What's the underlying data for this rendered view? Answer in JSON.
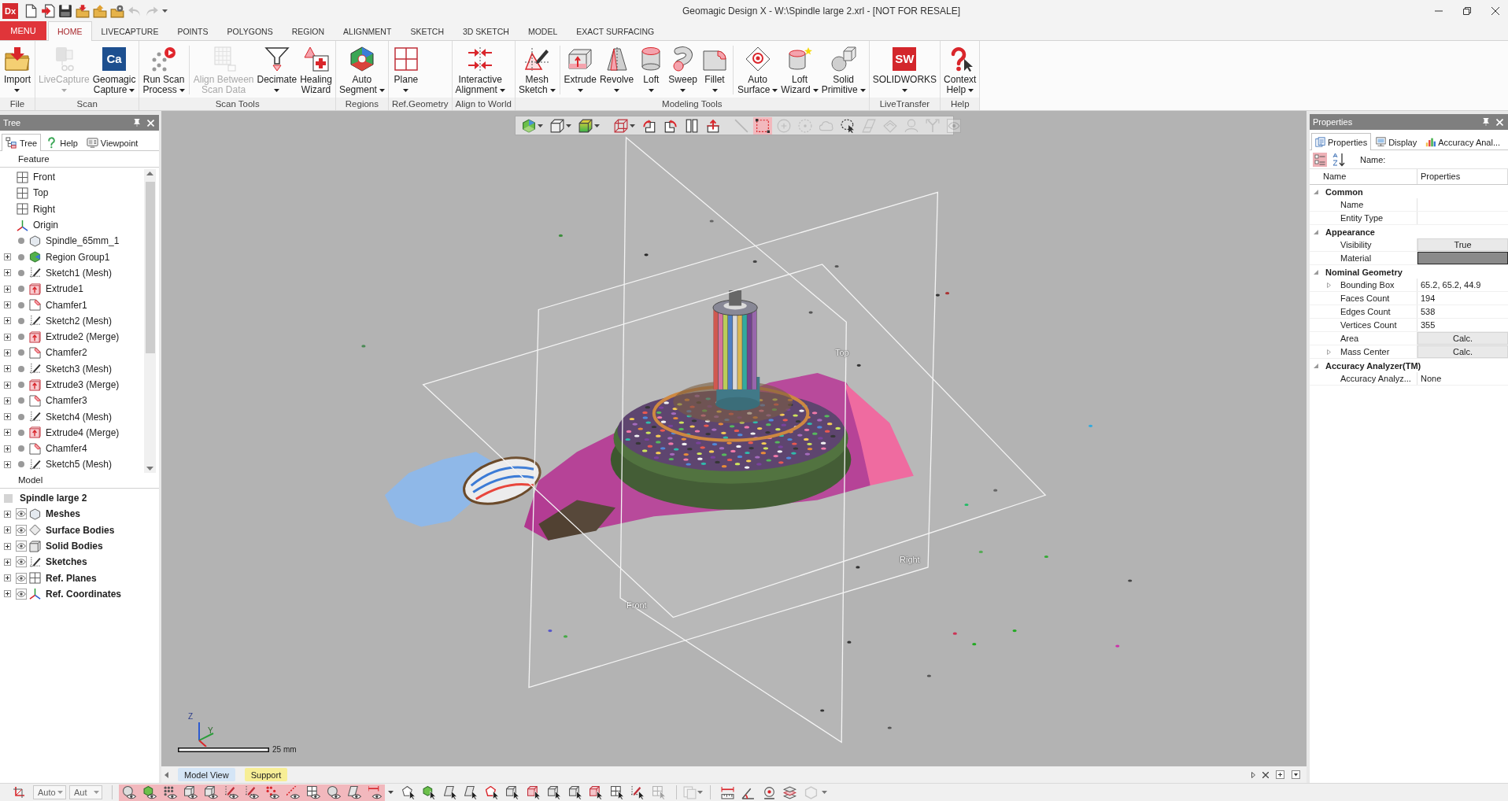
{
  "window": {
    "app_logo": "Dx",
    "title": "Geomagic Design X - W:\\Spindle large 2.xrl - [NOT FOR RESALE]"
  },
  "quick_access": [
    {
      "disabled": false
    },
    {
      "disabled": false
    },
    {
      "disabled": false
    },
    {
      "disabled": false
    },
    {
      "disabled": false
    },
    {
      "disabled": false
    },
    {
      "disabled": true
    },
    {
      "disabled": true
    }
  ],
  "ribbon": {
    "menu": "MENU",
    "tabs": [
      {
        "label": "HOME",
        "selected": true
      },
      {
        "label": "LIVECAPTURE",
        "selected": false
      },
      {
        "label": "POINTS",
        "selected": false
      },
      {
        "label": "POLYGONS",
        "selected": false
      },
      {
        "label": "REGION",
        "selected": false
      },
      {
        "label": "ALIGNMENT",
        "selected": false
      },
      {
        "label": "SKETCH",
        "selected": false
      },
      {
        "label": "3D SKETCH",
        "selected": false
      },
      {
        "label": "MODEL",
        "selected": false
      },
      {
        "label": "EXACT SURFACING",
        "selected": false
      }
    ],
    "groups": [
      {
        "label": "File",
        "sections": [
          [
            {
              "label": "Import",
              "dropdown": true,
              "disabled": false
            }
          ]
        ]
      },
      {
        "label": "Scan",
        "sections": [
          [
            {
              "label": "LiveCapture",
              "dropdown": true,
              "disabled": true
            },
            {
              "label": "Geomagic\nCapture",
              "badge": "Ca",
              "dropdown": true,
              "disabled": false
            }
          ]
        ]
      },
      {
        "label": "Scan Tools",
        "sections": [
          [
            {
              "label": "Run Scan\nProcess",
              "dropdown": true,
              "disabled": false
            }
          ],
          [
            {
              "label": "Align Between\nScan Data",
              "dropdown": false,
              "disabled": true
            },
            {
              "label": "Decimate",
              "dropdown": true,
              "disabled": false
            },
            {
              "label": "Healing\nWizard",
              "dropdown": false,
              "disabled": false
            }
          ]
        ]
      },
      {
        "label": "Regions",
        "sections": [
          [
            {
              "label": "Auto\nSegment",
              "dropdown": true,
              "disabled": false
            }
          ]
        ]
      },
      {
        "label": "Ref.Geometry",
        "sections": [
          [
            {
              "label": "Plane",
              "dropdown": true,
              "disabled": false
            }
          ]
        ]
      },
      {
        "label": "Align to World",
        "sections": [
          [
            {
              "label": "Interactive\nAlignment",
              "dropdown": true,
              "disabled": false
            }
          ]
        ]
      },
      {
        "label": "Modeling Tools",
        "sections": [
          [
            {
              "label": "Mesh\nSketch",
              "dropdown": true,
              "disabled": false
            }
          ],
          [
            {
              "label": "Extrude",
              "dropdown": true,
              "disabled": false
            },
            {
              "label": "Revolve",
              "dropdown": true,
              "disabled": false
            },
            {
              "label": "Loft",
              "dropdown": true,
              "disabled": false
            },
            {
              "label": "Sweep",
              "dropdown": true,
              "disabled": false
            },
            {
              "label": "Fillet",
              "dropdown": true,
              "disabled": false
            }
          ],
          [
            {
              "label": "Auto\nSurface",
              "dropdown": true,
              "disabled": false
            },
            {
              "label": "Loft\nWizard",
              "dropdown": true,
              "disabled": false
            },
            {
              "label": "Solid\nPrimitive",
              "dropdown": true,
              "disabled": false
            }
          ]
        ]
      },
      {
        "label": "LiveTransfer",
        "sections": [
          [
            {
              "label": "SOLIDWORKS",
              "badge": "SW",
              "dropdown": true,
              "disabled": false
            }
          ]
        ]
      },
      {
        "label": "Help",
        "sections": [
          [
            {
              "label": "Context\nHelp",
              "dropdown": true,
              "disabled": false
            }
          ]
        ]
      }
    ]
  },
  "tree_panel": {
    "title": "Tree",
    "tabs": [
      {
        "label": "Tree",
        "selected": true
      },
      {
        "label": "Help",
        "selected": false
      },
      {
        "label": "Viewpoint",
        "selected": false
      }
    ],
    "feature_header": "Feature",
    "features": [
      {
        "label": "Front",
        "kind": "plane",
        "expandable": false,
        "status_dot": false
      },
      {
        "label": "Top",
        "kind": "plane",
        "expandable": false,
        "status_dot": false
      },
      {
        "label": "Right",
        "kind": "plane",
        "expandable": false,
        "status_dot": false
      },
      {
        "label": "Origin",
        "kind": "origin",
        "expandable": false,
        "status_dot": false
      },
      {
        "label": "Spindle_65mm_1",
        "kind": "mesh",
        "expandable": false,
        "status_dot": true
      },
      {
        "label": "Region Group1",
        "kind": "region",
        "expandable": true,
        "expanded": false,
        "status_dot": true
      },
      {
        "label": "Sketch1 (Mesh)",
        "kind": "sketch",
        "expandable": true,
        "expanded": false,
        "status_dot": true
      },
      {
        "label": "Extrude1",
        "kind": "extrude",
        "expandable": true,
        "expanded": false,
        "status_dot": true
      },
      {
        "label": "Chamfer1",
        "kind": "chamfer",
        "expandable": true,
        "expanded": false,
        "status_dot": true
      },
      {
        "label": "Sketch2 (Mesh)",
        "kind": "sketch",
        "expandable": true,
        "expanded": false,
        "status_dot": true
      },
      {
        "label": "Extrude2 (Merge)",
        "kind": "extrude",
        "expandable": true,
        "expanded": false,
        "status_dot": true
      },
      {
        "label": "Chamfer2",
        "kind": "chamfer",
        "expandable": true,
        "expanded": false,
        "status_dot": true
      },
      {
        "label": "Sketch3 (Mesh)",
        "kind": "sketch",
        "expandable": true,
        "expanded": false,
        "status_dot": true
      },
      {
        "label": "Extrude3 (Merge)",
        "kind": "extrude",
        "expandable": true,
        "expanded": false,
        "status_dot": true
      },
      {
        "label": "Chamfer3",
        "kind": "chamfer",
        "expandable": true,
        "expanded": false,
        "status_dot": true
      },
      {
        "label": "Sketch4 (Mesh)",
        "kind": "sketch",
        "expandable": true,
        "expanded": false,
        "status_dot": true
      },
      {
        "label": "Extrude4 (Merge)",
        "kind": "extrude",
        "expandable": true,
        "expanded": false,
        "status_dot": true
      },
      {
        "label": "Chamfer4",
        "kind": "chamfer",
        "expandable": true,
        "expanded": false,
        "status_dot": true
      },
      {
        "label": "Sketch5 (Mesh)",
        "kind": "sketch",
        "expandable": true,
        "expanded": false,
        "status_dot": true
      }
    ],
    "model_header": "Model",
    "model": {
      "label": "Spindle large 2",
      "children": [
        {
          "label": "Meshes",
          "kind": "mesh",
          "expandable": true,
          "expanded": false,
          "visible": true
        },
        {
          "label": "Surface Bodies",
          "kind": "surface",
          "expandable": true,
          "expanded": false,
          "visible": true
        },
        {
          "label": "Solid Bodies",
          "kind": "solid",
          "expandable": true,
          "expanded": false,
          "visible": true
        },
        {
          "label": "Sketches",
          "kind": "sketch",
          "expandable": true,
          "expanded": false,
          "visible": true
        },
        {
          "label": "Ref. Planes",
          "kind": "plane",
          "expandable": true,
          "expanded": false,
          "visible": true
        },
        {
          "label": "Ref. Coordinates",
          "kind": "origin",
          "expandable": true,
          "expanded": false,
          "visible": true
        }
      ]
    }
  },
  "viewport": {
    "toolbar": [
      [
        {
          "dropdown": true,
          "selected": false,
          "disabled": false
        },
        {
          "dropdown": true,
          "selected": false,
          "disabled": false
        },
        {
          "dropdown": true,
          "selected": false,
          "disabled": false
        }
      ],
      [
        {
          "dropdown": true,
          "selected": false,
          "disabled": false
        },
        {
          "dropdown": false,
          "selected": false,
          "disabled": false
        },
        {
          "dropdown": false,
          "selected": false,
          "disabled": false
        },
        {
          "dropdown": false,
          "selected": false,
          "disabled": false
        },
        {
          "dropdown": false,
          "selected": false,
          "disabled": false
        }
      ],
      [
        {
          "dropdown": false,
          "selected": false,
          "disabled": true
        },
        {
          "dropdown": false,
          "selected": true,
          "disabled": false
        },
        {
          "dropdown": false,
          "selected": false,
          "disabled": true
        },
        {
          "dropdown": false,
          "selected": false,
          "disabled": true
        },
        {
          "dropdown": false,
          "selected": false,
          "disabled": true
        },
        {
          "dropdown": false,
          "selected": false,
          "disabled": false
        },
        {
          "dropdown": false,
          "selected": false,
          "disabled": true
        },
        {
          "dropdown": false,
          "selected": false,
          "disabled": true
        },
        {
          "dropdown": false,
          "selected": false,
          "disabled": true
        },
        {
          "dropdown": false,
          "selected": false,
          "disabled": true
        },
        {
          "dropdown": false,
          "selected": false,
          "disabled": true
        }
      ]
    ],
    "plane_labels": [
      "Top",
      "Right",
      "Front"
    ],
    "axis_labels": [
      "Z",
      "Y"
    ],
    "scale_label": "25 mm",
    "view_tabs": [
      {
        "label": "Model View",
        "color": "#d4e5f6"
      },
      {
        "label": "Support",
        "color": "#f7ee96"
      }
    ]
  },
  "properties_panel": {
    "title": "Properties",
    "tabs": [
      {
        "label": "Properties",
        "selected": true
      },
      {
        "label": "Display",
        "selected": false
      },
      {
        "label": "Accuracy Anal...",
        "selected": false
      }
    ],
    "toolbar": {
      "categorized_selected": true,
      "name_label": "Name:"
    },
    "columns": [
      "Name",
      "Properties"
    ],
    "categories": [
      {
        "label": "Common",
        "expanded": true,
        "rows": [
          {
            "name": "Name",
            "kind": "text",
            "expandable": false
          },
          {
            "name": "Entity Type",
            "kind": "text",
            "expandable": false
          }
        ]
      },
      {
        "label": "Appearance",
        "expanded": true,
        "rows": [
          {
            "name": "Visibility",
            "kind": "button",
            "value": "True",
            "expandable": false
          },
          {
            "name": "Material",
            "kind": "swatch",
            "color": "#8a8a8a",
            "expandable": false
          }
        ]
      },
      {
        "label": "Nominal Geometry",
        "expanded": true,
        "rows": [
          {
            "name": "Bounding Box",
            "kind": "text",
            "value": "65.2, 65.2, 44.9",
            "expandable": true
          },
          {
            "name": "Faces Count",
            "kind": "text",
            "value": "194",
            "expandable": false
          },
          {
            "name": "Edges Count",
            "kind": "text",
            "value": "538",
            "expandable": false
          },
          {
            "name": "Vertices Count",
            "kind": "text",
            "value": "355",
            "expandable": false
          },
          {
            "name": "Area",
            "kind": "button",
            "value": "Calc.",
            "expandable": false
          },
          {
            "name": "Mass Center",
            "kind": "button",
            "value": "Calc.",
            "expandable": true
          }
        ]
      },
      {
        "label": "Accuracy Analyzer(TM)",
        "expanded": true,
        "rows": [
          {
            "name": "Accuracy Analyz...",
            "kind": "text",
            "value": "None",
            "expandable": false
          }
        ]
      }
    ]
  },
  "status_toolbar": {
    "fields": [
      {
        "value": "Auto",
        "disabled": true
      },
      {
        "value": "Aut",
        "disabled": true
      }
    ],
    "filters": [
      {
        "on": true
      },
      {
        "on": true
      },
      {
        "on": true
      },
      {
        "on": true
      },
      {
        "on": true
      },
      {
        "on": true
      },
      {
        "on": true
      },
      {
        "on": true
      },
      {
        "on": true
      },
      {
        "on": true
      },
      {
        "on": true
      },
      {
        "on": true
      },
      {
        "on": true
      }
    ],
    "select_tools": [
      {
        "disabled": false
      },
      {
        "disabled": false
      },
      {
        "disabled": false
      },
      {
        "disabled": false
      },
      {
        "disabled": false
      },
      {
        "disabled": false
      },
      {
        "disabled": false
      },
      {
        "disabled": false
      },
      {
        "disabled": false
      },
      {
        "disabled": false
      },
      {
        "disabled": false
      },
      {
        "disabled": false
      },
      {
        "disabled": true
      }
    ],
    "view_tools": [
      {
        "disabled": true
      }
    ],
    "measure_tools": [
      {
        "disabled": false
      },
      {
        "disabled": false
      },
      {
        "disabled": false
      },
      {
        "disabled": false
      },
      {
        "disabled": true
      }
    ]
  }
}
